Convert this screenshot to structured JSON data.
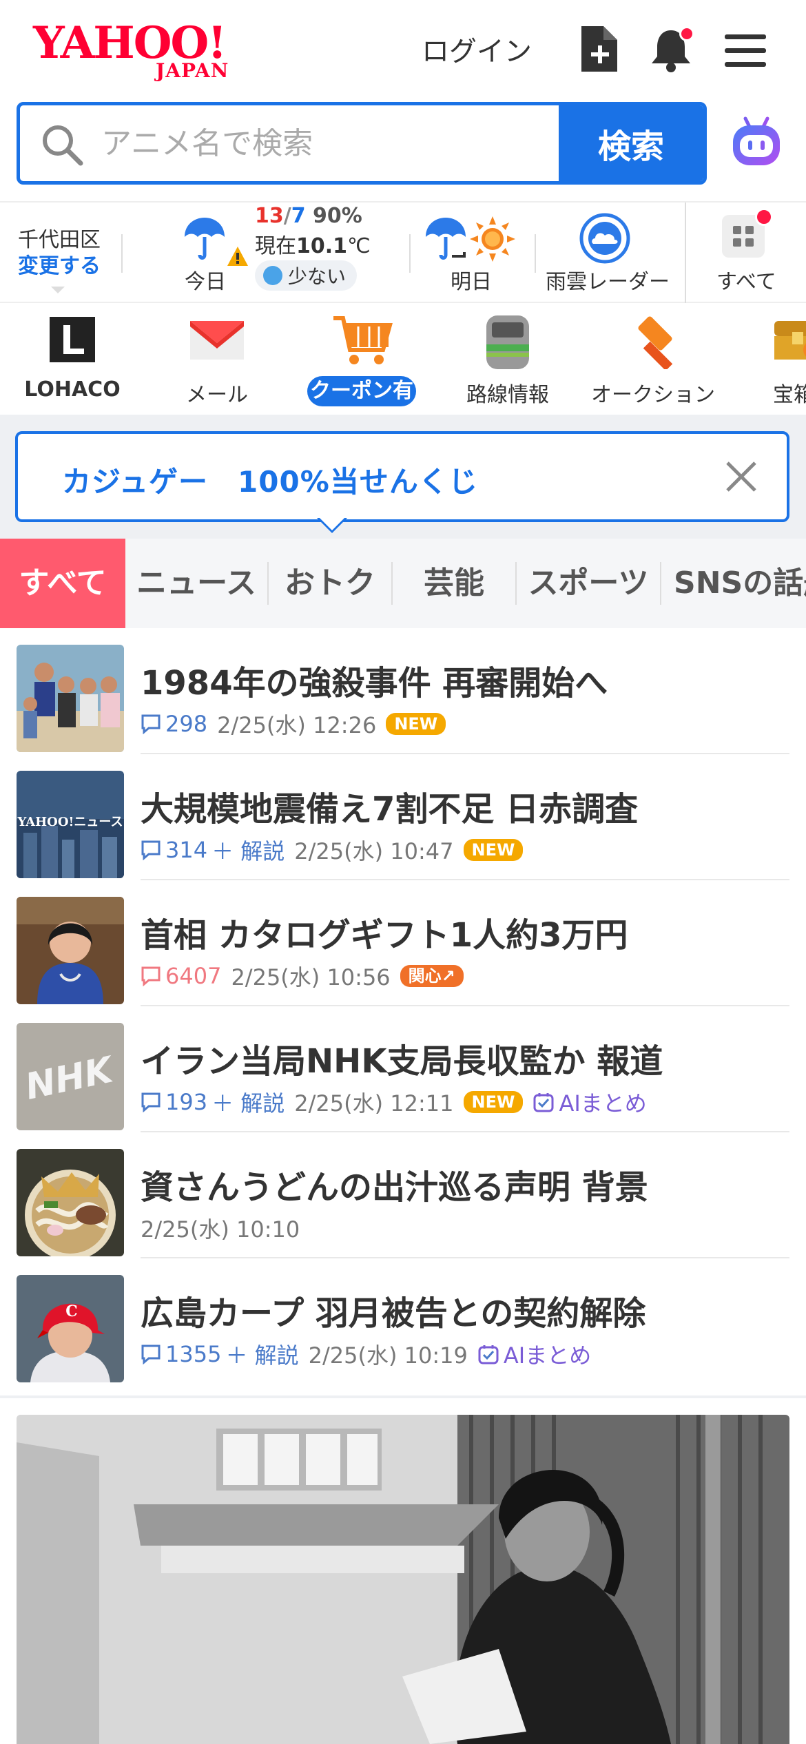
{
  "header": {
    "logo_main": "YAHOO!",
    "logo_sub": "JAPAN",
    "login_label": "ログイン"
  },
  "search": {
    "placeholder": "アニメ名で検索",
    "button_label": "検索"
  },
  "weather": {
    "location": "千代田区",
    "change_label": "変更する",
    "temp_high": "13",
    "temp_low": "7",
    "rain_chance": "90%",
    "now_prefix": "現在",
    "now_temp": "10.1",
    "now_unit": "℃",
    "rain_amount": "少ない",
    "today_label": "今日",
    "tomorrow_label": "明日",
    "radar_label": "雨雲レーダー",
    "all_label": "すべて"
  },
  "services": [
    {
      "label": "LOHACO"
    },
    {
      "label": "メール"
    },
    {
      "label": "クーポン有"
    },
    {
      "label": "路線情報"
    },
    {
      "label": "オークション"
    },
    {
      "label": "宝箱く"
    }
  ],
  "banner": {
    "text": "カジュゲー　100%当せんくじ"
  },
  "tabs": [
    {
      "label": "すべて"
    },
    {
      "label": "ニュース"
    },
    {
      "label": "おトク"
    },
    {
      "label": "芸能"
    },
    {
      "label": "スポーツ"
    },
    {
      "label": "SNSの話題"
    }
  ],
  "news": [
    {
      "title": "1984年の強殺事件 再審開始へ",
      "comments": "298",
      "explain": "",
      "time": "2/25(水) 12:26",
      "tag": "NEW",
      "ai": ""
    },
    {
      "title": "大規模地震備え7割不足 日赤調査",
      "comments": "314",
      "explain": "＋ 解説",
      "time": "2/25(水) 10:47",
      "tag": "NEW",
      "ai": ""
    },
    {
      "title": "首相 カタログギフト1人約3万円",
      "comments": "6407",
      "explain": "",
      "time": "2/25(水) 10:56",
      "tag": "関心↗",
      "ai": ""
    },
    {
      "title": "イラン当局NHK支局長収監か 報道",
      "comments": "193",
      "explain": "＋ 解説",
      "time": "2/25(水) 12:11",
      "tag": "NEW",
      "ai": "AIまとめ"
    },
    {
      "title": "資さんうどんの出汁巡る声明 背景",
      "comments": "",
      "explain": "",
      "time": "2/25(水) 10:10",
      "tag": "",
      "ai": ""
    },
    {
      "title": "広島カープ 羽月被告との契約解除",
      "comments": "1355",
      "explain": "＋ 解説",
      "time": "2/25(水) 10:19",
      "tag": "",
      "ai": "AIまとめ"
    }
  ],
  "thumb_texts": {
    "nhk": "NHK",
    "yahoo_news": "YAHOO!ニュース"
  },
  "colors": {
    "accent": "#1a72e6",
    "brand": "#ff0033",
    "tab_active": "#ff5a6e",
    "new_tag": "#f5a800"
  }
}
